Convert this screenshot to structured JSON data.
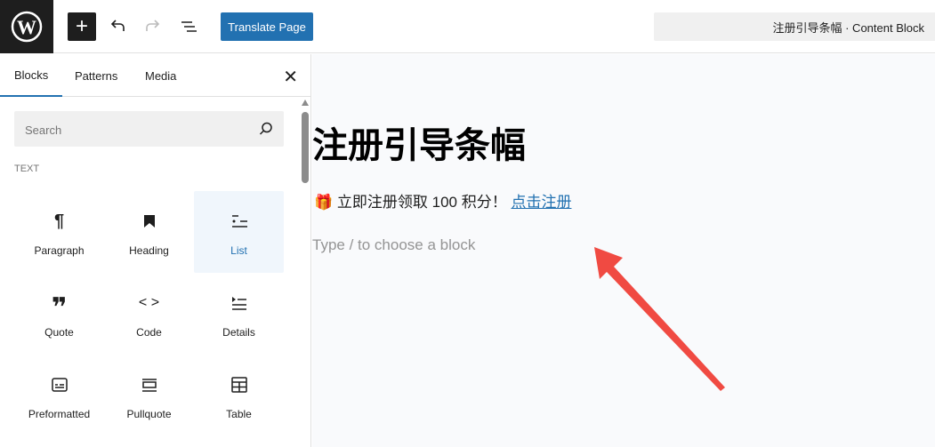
{
  "toolbar": {
    "translate_label": "Translate Page",
    "document_title": "注册引导条幅 · Content Block"
  },
  "sidebar": {
    "tabs": [
      "Blocks",
      "Patterns",
      "Media"
    ],
    "search_placeholder": "Search",
    "category": "TEXT",
    "blocks": [
      {
        "label": "Paragraph",
        "icon": "paragraph-icon"
      },
      {
        "label": "Heading",
        "icon": "heading-icon"
      },
      {
        "label": "List",
        "icon": "list-icon"
      },
      {
        "label": "Quote",
        "icon": "quote-icon"
      },
      {
        "label": "Code",
        "icon": "code-icon"
      },
      {
        "label": "Details",
        "icon": "details-icon"
      },
      {
        "label": "Preformatted",
        "icon": "preformatted-icon"
      },
      {
        "label": "Pullquote",
        "icon": "pullquote-icon"
      },
      {
        "label": "Table",
        "icon": "table-icon"
      }
    ]
  },
  "canvas": {
    "title": "注册引导条幅",
    "emoji": "🎁",
    "paragraph": "立即注册领取 100 积分！",
    "link": "点击注册",
    "placeholder": "Type / to choose a block"
  },
  "annotation_color": "#f04a42"
}
